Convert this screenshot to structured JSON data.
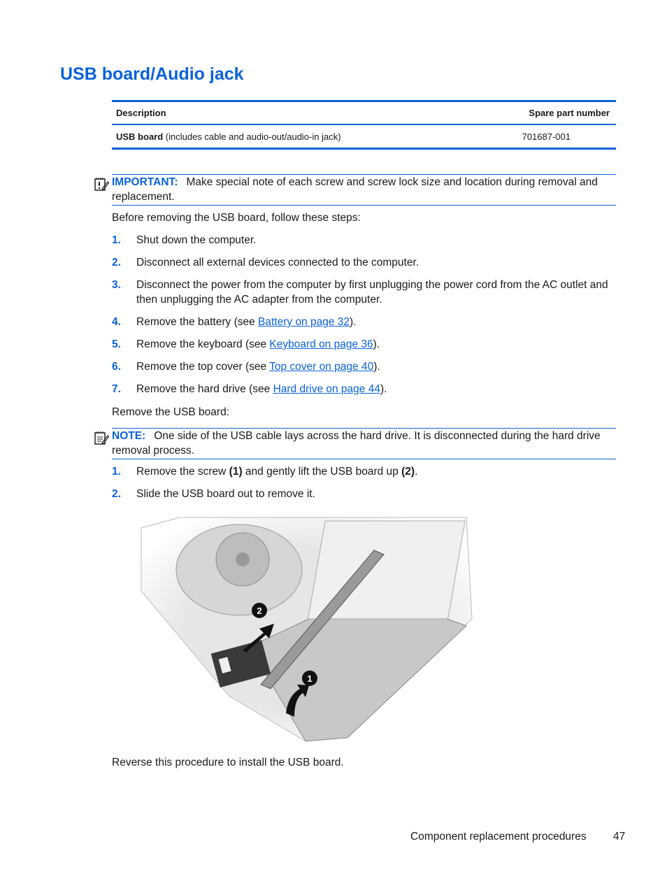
{
  "page": {
    "title": "USB board/Audio jack"
  },
  "parts_table": {
    "headers": [
      "Description",
      "Spare part number"
    ],
    "rows": [
      {
        "description_bold": "USB board",
        "description_rest": " (includes cable and audio-out/audio-in jack)",
        "part_number": "701687-001"
      }
    ]
  },
  "important_note": {
    "label": "IMPORTANT:",
    "text": "Make special note of each screw and screw lock size and location during removal and replacement.",
    "icon": "important-note-icon"
  },
  "prep_intro": "Before removing the USB board, follow these steps:",
  "prep_steps": [
    {
      "num": "1.",
      "text": "Shut down the computer."
    },
    {
      "num": "2.",
      "text": "Disconnect all external devices connected to the computer."
    },
    {
      "num": "3.",
      "text": "Disconnect the power from the computer by first unplugging the power cord from the AC outlet and then unplugging the AC adapter from the computer."
    },
    {
      "num": "4.",
      "pre": "Remove the battery (see ",
      "link": "Battery on page 32",
      "post": ")."
    },
    {
      "num": "5.",
      "pre": "Remove the keyboard (see ",
      "link": "Keyboard on page 36",
      "post": ")."
    },
    {
      "num": "6.",
      "pre": "Remove the top cover (see ",
      "link": "Top cover on page 40",
      "post": ")."
    },
    {
      "num": "7.",
      "pre": "Remove the hard drive (see ",
      "link": "Hard drive on page 44",
      "post": ")."
    }
  ],
  "remove_intro": "Remove the USB board:",
  "note": {
    "label": "NOTE:",
    "text": "One side of the USB cable lays across the hard drive. It is disconnected during the hard drive removal process.",
    "icon": "note-icon"
  },
  "remove_steps": [
    {
      "num": "1.",
      "t1": "Remove the screw ",
      "b1": "(1)",
      "t2": " and gently lift the USB board up ",
      "b2": "(2)",
      "t3": "."
    },
    {
      "num": "2.",
      "text": "Slide the USB board out to remove it."
    }
  ],
  "figure": {
    "callouts": [
      "1",
      "2"
    ],
    "description": "USB board removal illustration"
  },
  "closing": "Reverse this procedure to install the USB board.",
  "footer": {
    "section": "Component replacement procedures",
    "page_number": "47"
  }
}
